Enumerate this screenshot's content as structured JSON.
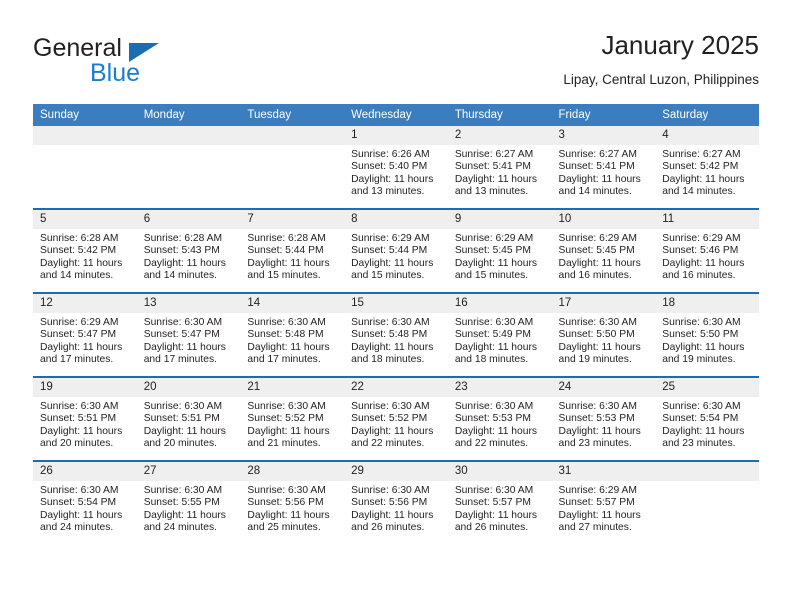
{
  "brand": {
    "name_top": "General",
    "name_bottom": "Blue",
    "triangle_icon": "triangle-icon",
    "color_dark": "#231f20",
    "color_blue": "#1b7cd0"
  },
  "header": {
    "title": "January 2025",
    "subtitle": "Lipay, Central Luzon, Philippines"
  },
  "theme": {
    "header_bg": "#3a7ebf",
    "row_divider": "#1b6cb0",
    "daynum_bg": "#efefef",
    "text": "#231f20"
  },
  "calendar": {
    "weekday_headers": [
      "Sunday",
      "Monday",
      "Tuesday",
      "Wednesday",
      "Thursday",
      "Friday",
      "Saturday"
    ],
    "weeks": [
      [
        {
          "day": "",
          "lines": []
        },
        {
          "day": "",
          "lines": []
        },
        {
          "day": "",
          "lines": []
        },
        {
          "day": "1",
          "lines": [
            "Sunrise: 6:26 AM",
            "Sunset: 5:40 PM",
            "Daylight: 11 hours",
            "and 13 minutes."
          ]
        },
        {
          "day": "2",
          "lines": [
            "Sunrise: 6:27 AM",
            "Sunset: 5:41 PM",
            "Daylight: 11 hours",
            "and 13 minutes."
          ]
        },
        {
          "day": "3",
          "lines": [
            "Sunrise: 6:27 AM",
            "Sunset: 5:41 PM",
            "Daylight: 11 hours",
            "and 14 minutes."
          ]
        },
        {
          "day": "4",
          "lines": [
            "Sunrise: 6:27 AM",
            "Sunset: 5:42 PM",
            "Daylight: 11 hours",
            "and 14 minutes."
          ]
        }
      ],
      [
        {
          "day": "5",
          "lines": [
            "Sunrise: 6:28 AM",
            "Sunset: 5:42 PM",
            "Daylight: 11 hours",
            "and 14 minutes."
          ]
        },
        {
          "day": "6",
          "lines": [
            "Sunrise: 6:28 AM",
            "Sunset: 5:43 PM",
            "Daylight: 11 hours",
            "and 14 minutes."
          ]
        },
        {
          "day": "7",
          "lines": [
            "Sunrise: 6:28 AM",
            "Sunset: 5:44 PM",
            "Daylight: 11 hours",
            "and 15 minutes."
          ]
        },
        {
          "day": "8",
          "lines": [
            "Sunrise: 6:29 AM",
            "Sunset: 5:44 PM",
            "Daylight: 11 hours",
            "and 15 minutes."
          ]
        },
        {
          "day": "9",
          "lines": [
            "Sunrise: 6:29 AM",
            "Sunset: 5:45 PM",
            "Daylight: 11 hours",
            "and 15 minutes."
          ]
        },
        {
          "day": "10",
          "lines": [
            "Sunrise: 6:29 AM",
            "Sunset: 5:45 PM",
            "Daylight: 11 hours",
            "and 16 minutes."
          ]
        },
        {
          "day": "11",
          "lines": [
            "Sunrise: 6:29 AM",
            "Sunset: 5:46 PM",
            "Daylight: 11 hours",
            "and 16 minutes."
          ]
        }
      ],
      [
        {
          "day": "12",
          "lines": [
            "Sunrise: 6:29 AM",
            "Sunset: 5:47 PM",
            "Daylight: 11 hours",
            "and 17 minutes."
          ]
        },
        {
          "day": "13",
          "lines": [
            "Sunrise: 6:30 AM",
            "Sunset: 5:47 PM",
            "Daylight: 11 hours",
            "and 17 minutes."
          ]
        },
        {
          "day": "14",
          "lines": [
            "Sunrise: 6:30 AM",
            "Sunset: 5:48 PM",
            "Daylight: 11 hours",
            "and 17 minutes."
          ]
        },
        {
          "day": "15",
          "lines": [
            "Sunrise: 6:30 AM",
            "Sunset: 5:48 PM",
            "Daylight: 11 hours",
            "and 18 minutes."
          ]
        },
        {
          "day": "16",
          "lines": [
            "Sunrise: 6:30 AM",
            "Sunset: 5:49 PM",
            "Daylight: 11 hours",
            "and 18 minutes."
          ]
        },
        {
          "day": "17",
          "lines": [
            "Sunrise: 6:30 AM",
            "Sunset: 5:50 PM",
            "Daylight: 11 hours",
            "and 19 minutes."
          ]
        },
        {
          "day": "18",
          "lines": [
            "Sunrise: 6:30 AM",
            "Sunset: 5:50 PM",
            "Daylight: 11 hours",
            "and 19 minutes."
          ]
        }
      ],
      [
        {
          "day": "19",
          "lines": [
            "Sunrise: 6:30 AM",
            "Sunset: 5:51 PM",
            "Daylight: 11 hours",
            "and 20 minutes."
          ]
        },
        {
          "day": "20",
          "lines": [
            "Sunrise: 6:30 AM",
            "Sunset: 5:51 PM",
            "Daylight: 11 hours",
            "and 20 minutes."
          ]
        },
        {
          "day": "21",
          "lines": [
            "Sunrise: 6:30 AM",
            "Sunset: 5:52 PM",
            "Daylight: 11 hours",
            "and 21 minutes."
          ]
        },
        {
          "day": "22",
          "lines": [
            "Sunrise: 6:30 AM",
            "Sunset: 5:52 PM",
            "Daylight: 11 hours",
            "and 22 minutes."
          ]
        },
        {
          "day": "23",
          "lines": [
            "Sunrise: 6:30 AM",
            "Sunset: 5:53 PM",
            "Daylight: 11 hours",
            "and 22 minutes."
          ]
        },
        {
          "day": "24",
          "lines": [
            "Sunrise: 6:30 AM",
            "Sunset: 5:53 PM",
            "Daylight: 11 hours",
            "and 23 minutes."
          ]
        },
        {
          "day": "25",
          "lines": [
            "Sunrise: 6:30 AM",
            "Sunset: 5:54 PM",
            "Daylight: 11 hours",
            "and 23 minutes."
          ]
        }
      ],
      [
        {
          "day": "26",
          "lines": [
            "Sunrise: 6:30 AM",
            "Sunset: 5:54 PM",
            "Daylight: 11 hours",
            "and 24 minutes."
          ]
        },
        {
          "day": "27",
          "lines": [
            "Sunrise: 6:30 AM",
            "Sunset: 5:55 PM",
            "Daylight: 11 hours",
            "and 24 minutes."
          ]
        },
        {
          "day": "28",
          "lines": [
            "Sunrise: 6:30 AM",
            "Sunset: 5:56 PM",
            "Daylight: 11 hours",
            "and 25 minutes."
          ]
        },
        {
          "day": "29",
          "lines": [
            "Sunrise: 6:30 AM",
            "Sunset: 5:56 PM",
            "Daylight: 11 hours",
            "and 26 minutes."
          ]
        },
        {
          "day": "30",
          "lines": [
            "Sunrise: 6:30 AM",
            "Sunset: 5:57 PM",
            "Daylight: 11 hours",
            "and 26 minutes."
          ]
        },
        {
          "day": "31",
          "lines": [
            "Sunrise: 6:29 AM",
            "Sunset: 5:57 PM",
            "Daylight: 11 hours",
            "and 27 minutes."
          ]
        },
        {
          "day": "",
          "lines": []
        }
      ]
    ]
  }
}
